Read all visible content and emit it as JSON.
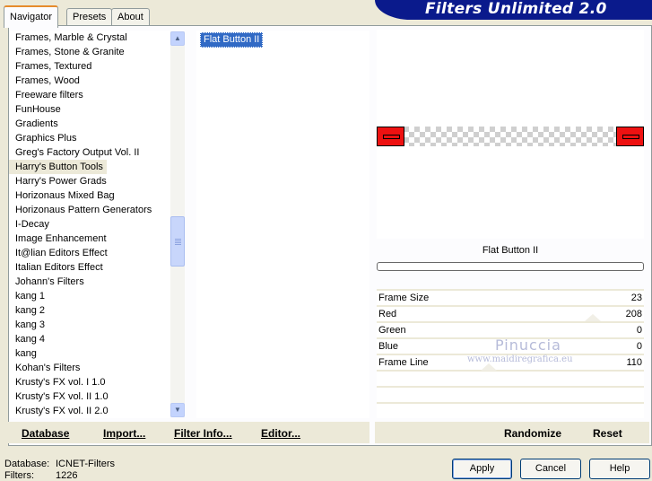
{
  "app": {
    "title": "Filters Unlimited 2.0"
  },
  "tabs": [
    {
      "label": "Navigator"
    },
    {
      "label": "Presets"
    },
    {
      "label": "About"
    }
  ],
  "categories": {
    "items": [
      "Frames, Marble & Crystal",
      "Frames, Stone & Granite",
      "Frames, Textured",
      "Frames, Wood",
      "Freeware filters",
      "FunHouse",
      "Gradients",
      "Graphics Plus",
      "Greg's Factory Output Vol. II",
      "Harry's Button Tools",
      "Harry's Power Grads",
      "Horizonaus Mixed Bag",
      "Horizonaus Pattern Generators",
      "I-Decay",
      "Image Enhancement",
      "It@lian Editors Effect",
      "Italian Editors Effect",
      "Johann's Filters",
      "kang 1",
      "kang 2",
      "kang 3",
      "kang 4",
      "kang",
      "Kohan's Filters",
      "Krusty's FX vol. I 1.0",
      "Krusty's FX vol. II 1.0",
      "Krusty's FX vol. II 2.0"
    ],
    "selected": "Harry's Button Tools"
  },
  "filters": {
    "items": [
      "Flat Button II"
    ],
    "selected": "Flat Button II"
  },
  "preview": {
    "filter_name": "Flat Button II",
    "colors": {
      "cap": "#ee1111"
    }
  },
  "parameters": [
    {
      "label": "Frame Size",
      "value": "23"
    },
    {
      "label": "Red",
      "value": "208"
    },
    {
      "label": "Green",
      "value": "0"
    },
    {
      "label": "Blue",
      "value": "0"
    },
    {
      "label": "Frame Line",
      "value": "110"
    }
  ],
  "watermark": {
    "line1": "Pinuccia",
    "line2": "www.maidiregrafica.eu"
  },
  "links": {
    "database": "Database",
    "import": "Import...",
    "filter_info": "Filter Info...",
    "editor": "Editor...",
    "randomize": "Randomize",
    "reset": "Reset"
  },
  "footer": {
    "database_label": "Database:",
    "database_value": "ICNET-Filters",
    "filters_label": "Filters:",
    "filters_value": "1226"
  },
  "buttons": {
    "apply": "Apply",
    "cancel": "Cancel",
    "help": "Help"
  }
}
